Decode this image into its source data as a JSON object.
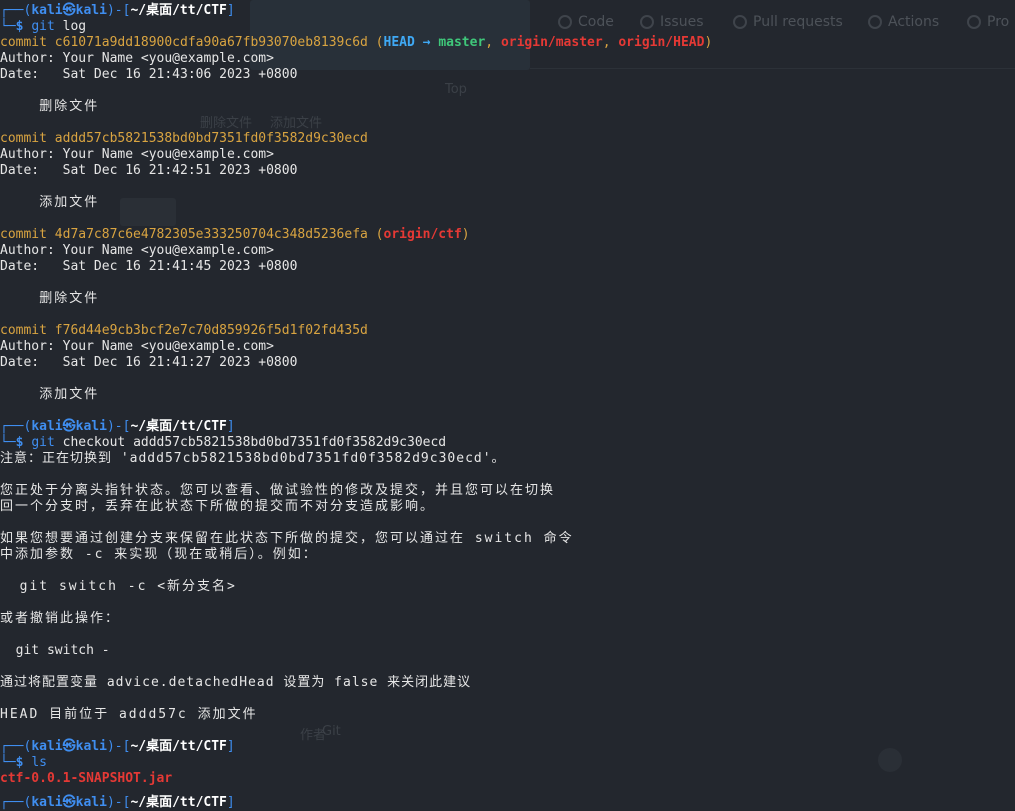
{
  "background": {
    "tabs": [
      "Code",
      "Issues",
      "Pull requests",
      "Actions",
      "Pro"
    ],
    "faint_texts": [
      "Top",
      "删除文件",
      "添加文件",
      "作者",
      "Git"
    ]
  },
  "prompt": {
    "user": "kali",
    "symbol": "㉿",
    "host": "kali",
    "dir": "~/桌面/tt/CTF",
    "dollar": "$"
  },
  "session": {
    "cmd1": {
      "program": "git",
      "args": " log"
    },
    "commits": [
      {
        "hash": "commit c61071a9dd18900cdfa90a67fb93070eb8139c6d",
        "refs": {
          "head": "HEAD",
          "arrow": "→",
          "branch": "master",
          "remote1": "origin/master",
          "remote2": "origin/HEAD"
        },
        "author": "Author: Your Name <you@example.com>",
        "date": "Date:   Sat Dec 16 21:43:06 2023 +0800",
        "message": "    删除文件"
      },
      {
        "hash": "commit addd57cb5821538bd0bd7351fd0f3582d9c30ecd",
        "author": "Author: Your Name <you@example.com>",
        "date": "Date:   Sat Dec 16 21:42:51 2023 +0800",
        "message": "    添加文件"
      },
      {
        "hash": "commit 4d7a7c87c6e4782305e333250704c348d5236efa",
        "refs": {
          "remote1": "origin/ctf"
        },
        "author": "Author: Your Name <you@example.com>",
        "date": "Date:   Sat Dec 16 21:41:45 2023 +0800",
        "message": "    删除文件"
      },
      {
        "hash": "commit f76d44e9cb3bcf2e7c70d859926f5d1f02fd435d",
        "author": "Author: Your Name <you@example.com>",
        "date": "Date:   Sat Dec 16 21:41:27 2023 +0800",
        "message": "    添加文件"
      }
    ],
    "cmd2": {
      "program": "git",
      "args": " checkout addd57cb5821538bd0bd7351fd0f3582d9c30ecd"
    },
    "checkout_output": [
      "注意：正在切换到 'addd57cb5821538bd0bd7351fd0f3582d9c30ecd'。",
      "您正处于分离头指针状态。您可以查看、做试验性的修改及提交，并且您可以在切换",
      "回一个分支时，丢弃在此状态下所做的提交而不对分支造成影响。",
      "如果您想要通过创建分支来保留在此状态下所做的提交，您可以通过在 switch 命令",
      "中添加参数 -c 来实现（现在或稍后）。例如：",
      "  git switch -c <新分支名>",
      "或者撤销此操作：",
      "  git switch -",
      "通过将配置变量 advice.detachedHead 设置为 false 来关闭此建议",
      "HEAD 目前位于 addd57c 添加文件"
    ],
    "cmd3": {
      "program": "ls"
    },
    "ls_output": "ctf-0.0.1-SNAPSHOT.jar"
  }
}
